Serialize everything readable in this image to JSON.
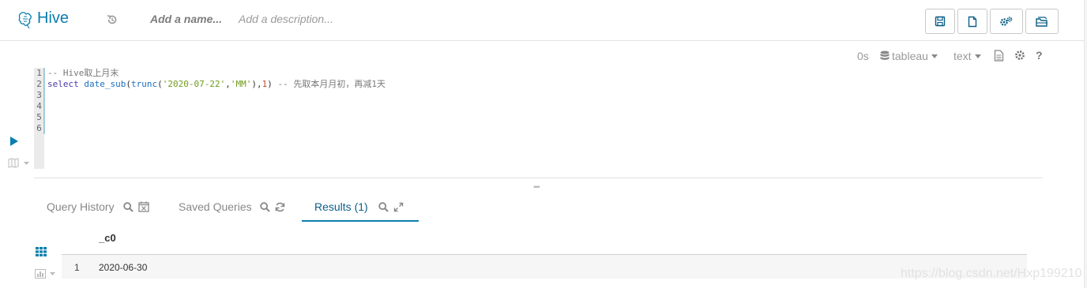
{
  "header": {
    "app_title": "Hive",
    "name_placeholder": "Add a name...",
    "description_placeholder": "Add a description...",
    "buttons": [
      "save-icon",
      "new-document-icon",
      "settings-cogs-icon",
      "open-folder-icon"
    ]
  },
  "editor_toolbar": {
    "timer": "0s",
    "database": "tableau",
    "mode": "text"
  },
  "editor": {
    "line_numbers": [
      "1",
      "2",
      "3",
      "4",
      "5",
      "6"
    ],
    "line1_comment": "-- Hive取上月末",
    "line2": {
      "kw": "select",
      "fn1": "date_sub",
      "p1": "(",
      "fn2": "trunc",
      "p2": "(",
      "s1": "'2020-07-22'",
      "c1": ",",
      "s2": "'MM'",
      "p3": "),",
      "n1": "1",
      "p4": ")",
      "comment": "-- 先取本月月初，再减1天"
    }
  },
  "tabs": {
    "query_history": "Query History",
    "saved_queries": "Saved Queries",
    "results": "Results (1)"
  },
  "results": {
    "columns": [
      "_c0"
    ],
    "rows": [
      {
        "index": "1",
        "values": [
          "2020-06-30"
        ]
      }
    ]
  },
  "watermark": "https://blog.csdn.net/Hxp199210",
  "colors": {
    "accent": "#0b7fad",
    "text_muted": "#9a9a9a"
  }
}
